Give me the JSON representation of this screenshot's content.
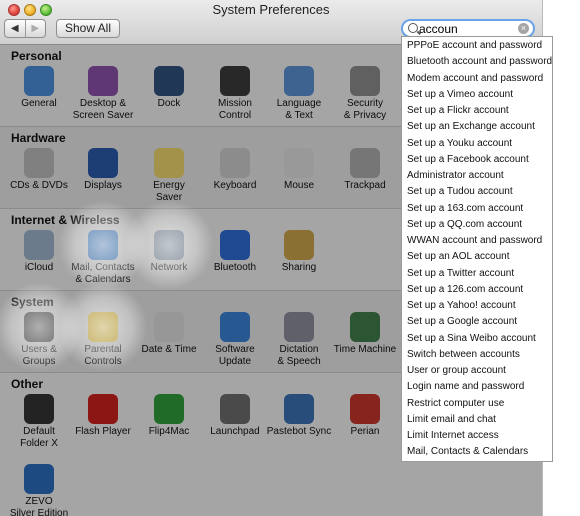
{
  "window": {
    "title": "System Preferences",
    "nav_back": "◀",
    "nav_forward": "▶",
    "show_all": "Show All",
    "search_value": "accoun",
    "search_clear": "×"
  },
  "sections": [
    {
      "title": "Personal",
      "items": [
        {
          "label": "General",
          "icon": "general-icon",
          "color": "#4a8bd6"
        },
        {
          "label": "Desktop &\nScreen Saver",
          "icon": "desktop-icon",
          "color": "#8a4fa8"
        },
        {
          "label": "Dock",
          "icon": "dock-icon",
          "color": "#2f4f7a"
        },
        {
          "label": "Mission\nControl",
          "icon": "mission-control-icon",
          "color": "#3a3a3a"
        },
        {
          "label": "Language\n& Text",
          "icon": "language-icon",
          "color": "#5b8fcf"
        },
        {
          "label": "Security\n& Privacy",
          "icon": "security-icon",
          "color": "#8a8a8a"
        }
      ]
    },
    {
      "title": "Hardware",
      "items": [
        {
          "label": "CDs & DVDs",
          "icon": "cd-icon",
          "color": "#b8b8b8"
        },
        {
          "label": "Displays",
          "icon": "displays-icon",
          "color": "#2a5aa8"
        },
        {
          "label": "Energy\nSaver",
          "icon": "energy-saver-icon",
          "color": "#e9d26a"
        },
        {
          "label": "Keyboard",
          "icon": "keyboard-icon",
          "color": "#c9c9c9"
        },
        {
          "label": "Mouse",
          "icon": "mouse-icon",
          "color": "#dcdcdc"
        },
        {
          "label": "Trackpad",
          "icon": "trackpad-icon",
          "color": "#a9a9a9"
        }
      ]
    },
    {
      "title": "Internet & Wireless",
      "items": [
        {
          "label": "iCloud",
          "icon": "icloud-icon",
          "color": "#9ab0c8"
        },
        {
          "label": "Mail, Contacts\n& Calendars",
          "icon": "mail-icon",
          "color": "#2f7fdc"
        },
        {
          "label": "Network",
          "icon": "network-icon",
          "color": "#7a8fa8"
        },
        {
          "label": "Bluetooth",
          "icon": "bluetooth-icon",
          "color": "#2d6bd0"
        },
        {
          "label": "Sharing",
          "icon": "sharing-icon",
          "color": "#c6a24a"
        }
      ]
    },
    {
      "title": "System",
      "items": [
        {
          "label": "Users &\nGroups",
          "icon": "users-icon",
          "color": "#2a2a2a"
        },
        {
          "label": "Parental\nControls",
          "icon": "parental-controls-icon",
          "color": "#f0c21a"
        },
        {
          "label": "Date & Time",
          "icon": "date-time-icon",
          "color": "#d8d8d8"
        },
        {
          "label": "Software\nUpdate",
          "icon": "software-update-icon",
          "color": "#3a7fd0"
        },
        {
          "label": "Dictation\n& Speech",
          "icon": "dictation-icon",
          "color": "#8a8a9a"
        },
        {
          "label": "Time Machine",
          "icon": "time-machine-icon",
          "color": "#3f7a4a"
        }
      ]
    },
    {
      "title": "Other",
      "items": [
        {
          "label": "Default\nFolder X",
          "icon": "default-folder-icon",
          "color": "#333333"
        },
        {
          "label": "Flash Player",
          "icon": "flash-player-icon",
          "color": "#c8201e"
        },
        {
          "label": "Flip4Mac",
          "icon": "flip4mac-icon",
          "color": "#2f9a3a"
        },
        {
          "label": "Launchpad",
          "icon": "launchpad-icon",
          "color": "#6a6a6a"
        },
        {
          "label": "Pastebot Sync",
          "icon": "pastebot-icon",
          "color": "#3a6fb0"
        },
        {
          "label": "Perian",
          "icon": "perian-icon",
          "color": "#c0342a"
        },
        {
          "label": "ZEVO\nSilver Edition",
          "icon": "zevo-icon",
          "color": "#2a6ab8"
        }
      ]
    }
  ],
  "results": [
    "PPPoE account and password",
    "Bluetooth account and password",
    "Modem account and password",
    "Set up a Vimeo account",
    "Set up a Flickr account",
    "Set up an Exchange account",
    "Set up a Youku account",
    "Set up a Facebook account",
    "Administrator account",
    "Set up a Tudou account",
    "Set up a 163.com account",
    "Set up a QQ.com account",
    "WWAN account and password",
    "Set up an AOL account",
    "Set up a Twitter account",
    "Set up a 126.com account",
    "Set up a Yahoo! account",
    "Set up a Google account",
    "Set up a Sina Weibo account",
    "Switch between accounts",
    "User or group account",
    "Login name and password",
    "Restrict computer use",
    "Limit email and chat",
    "Limit Internet access",
    "Mail, Contacts & Calendars"
  ]
}
